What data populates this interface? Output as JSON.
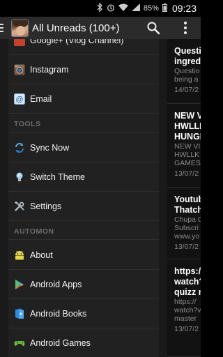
{
  "status": {
    "battery": "85%",
    "time": "09:23"
  },
  "header": {
    "title": "All Unreads (100+)"
  },
  "drawer": {
    "partial_item": "Google+ (Vlog Channel)",
    "items_top": [
      {
        "label": "Instagram"
      },
      {
        "label": "Email"
      }
    ],
    "tools_header": "TOOLS",
    "tools": [
      {
        "label": "Sync Now"
      },
      {
        "label": "Switch Theme"
      },
      {
        "label": "Settings"
      }
    ],
    "automon_header": "AUTOMON",
    "automon": [
      {
        "label": "About"
      },
      {
        "label": "Android Apps"
      },
      {
        "label": "Android Books"
      },
      {
        "label": "Android Games"
      }
    ]
  },
  "articles": [
    {
      "title1": "Questio",
      "title2": "ingredi",
      "body1": "Questio",
      "body2": "being a",
      "date": "14/07/2"
    },
    {
      "title1": "NEW VI",
      "title2": "HWLLK",
      "title3": "HUNGE",
      "body1": "NEW VI",
      "body2": "HWLLK",
      "body3": "GAMES",
      "date": "13/07/2"
    },
    {
      "title1": "Youtub",
      "title2": "Thatch",
      "body1": "Chupa C",
      "body2": "Subscri",
      "body3": "www.yo",
      "date": "13/07/2"
    },
    {
      "title1": "https:/",
      "title2": "watch?",
      "title3": "quizz n",
      "body1": "https://",
      "body2": "watch?v",
      "body3": "master",
      "date": "13/07/2"
    }
  ]
}
